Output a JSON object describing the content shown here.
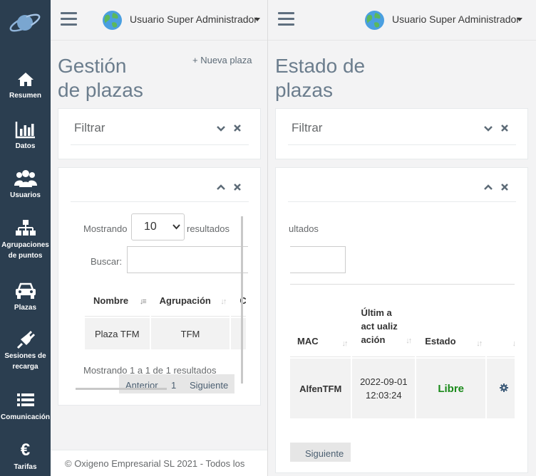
{
  "sidebar": {
    "items": [
      {
        "label": "Resumen",
        "icon": "home-icon"
      },
      {
        "label": "Datos",
        "icon": "bar-chart-icon"
      },
      {
        "label": "Usuarios",
        "icon": "users-icon"
      },
      {
        "label": "Agrupaciones de puntos",
        "icon": "sitemap-icon"
      },
      {
        "label": "Plazas",
        "icon": "car-icon"
      },
      {
        "label": "Sesiones de recarga",
        "icon": "plug-icon"
      },
      {
        "label": "Comunicación",
        "icon": "list-icon"
      },
      {
        "label": "Tarifas",
        "icon": "euro-icon"
      }
    ]
  },
  "header": {
    "user_name": "Usuario Super Administrador"
  },
  "left_panel": {
    "title_line1": "Gestión",
    "title_line2": "de plazas",
    "new_button": "+ Nueva plaza",
    "filter_title": "Filtrar",
    "showing_prefix": "Mostrando",
    "page_size": "10",
    "showing_suffix": "resultados",
    "search_label": "Buscar:",
    "columns": [
      "Nombre",
      "Agrupación",
      "C"
    ],
    "rows": [
      [
        "Plaza TFM",
        "TFM"
      ]
    ],
    "info": "Mostrando 1 a 1 de 1 resultados",
    "pagination": {
      "prev": "Anterior",
      "page": "1",
      "next": "Siguiente"
    },
    "footer": "© Oxigeno Empresarial SL 2021 - Todos los"
  },
  "right_panel": {
    "title_line1": "Estado de",
    "title_line2": "plazas",
    "filter_title": "Filtrar",
    "showing_suffix_partial": "ultados",
    "columns": [
      "MAC",
      "Últim a act ualiz ación",
      "Estado",
      "",
      ""
    ],
    "rows": [
      [
        "AlfenTFM",
        "2022-09-01 12:03:24",
        "Libre"
      ]
    ],
    "status_color": "#1a8a1a",
    "pagination": {
      "next": "Siguiente"
    }
  },
  "colors": {
    "sidebar": "#2b3e50",
    "accent_title": "#6b7d8d"
  }
}
